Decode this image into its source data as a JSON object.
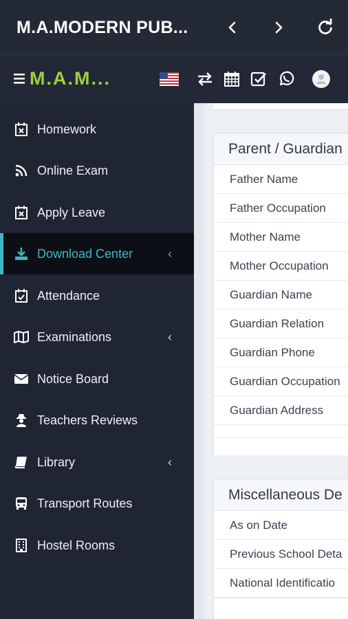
{
  "appbar": {
    "title": "M.A.MODERN PUB...",
    "back_icon": "chevron-left-icon",
    "forward_icon": "chevron-right-icon",
    "refresh_icon": "refresh-icon"
  },
  "topnav": {
    "brand": "M.A.M...",
    "icons": [
      "flag-us-icon",
      "swap-icon",
      "calendar-icon",
      "check-square-icon",
      "whatsapp-icon",
      "avatar-icon"
    ]
  },
  "sidebar": {
    "items": [
      {
        "label": "Homework",
        "icon": "calendar-x-icon"
      },
      {
        "label": "Online Exam",
        "icon": "rss-icon"
      },
      {
        "label": "Apply Leave",
        "icon": "calendar-x-icon"
      },
      {
        "label": "Download Center",
        "icon": "download-icon",
        "active": true,
        "chevron": "‹"
      },
      {
        "label": "Attendance",
        "icon": "calendar-check-icon"
      },
      {
        "label": "Examinations",
        "icon": "map-icon",
        "chevron": "‹"
      },
      {
        "label": "Notice Board",
        "icon": "envelope-icon"
      },
      {
        "label": "Teachers Reviews",
        "icon": "user-secret-icon"
      },
      {
        "label": "Library",
        "icon": "book-icon",
        "chevron": "‹"
      },
      {
        "label": "Transport Routes",
        "icon": "bus-icon"
      },
      {
        "label": "Hostel Rooms",
        "icon": "building-icon"
      }
    ]
  },
  "panels": {
    "guardian": {
      "title": "Parent / Guardian",
      "rows": [
        "Father Name",
        "Father Occupation",
        "Mother Name",
        "Mother Occupation",
        "Guardian Name",
        "Guardian Relation",
        "Guardian Phone",
        "Guardian Occupation",
        "Guardian Address"
      ]
    },
    "misc": {
      "title": "Miscellaneous De",
      "rows": [
        "As on Date",
        "Previous School Deta",
        "National Identificatio"
      ]
    }
  },
  "colors": {
    "accent": "#3fb6c8",
    "brand": "#9ed03e",
    "sidebar_bg": "#1f2532"
  }
}
